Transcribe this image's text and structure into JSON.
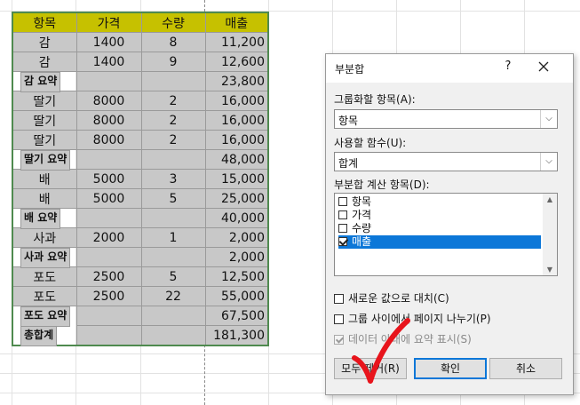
{
  "sheet": {
    "headers": [
      "항목",
      "가격",
      "수량",
      "매출"
    ],
    "rows": [
      {
        "item": "감",
        "price": "1400",
        "qty": "8",
        "sales": "11,200",
        "type": "data"
      },
      {
        "item": "감",
        "price": "1400",
        "qty": "9",
        "sales": "12,600",
        "type": "data"
      },
      {
        "item": "감 요약",
        "price": "",
        "qty": "",
        "sales": "23,800",
        "type": "sum"
      },
      {
        "item": "딸기",
        "price": "8000",
        "qty": "2",
        "sales": "16,000",
        "type": "data"
      },
      {
        "item": "딸기",
        "price": "8000",
        "qty": "2",
        "sales": "16,000",
        "type": "data"
      },
      {
        "item": "딸기",
        "price": "8000",
        "qty": "2",
        "sales": "16,000",
        "type": "data"
      },
      {
        "item": "딸기 요약",
        "price": "",
        "qty": "",
        "sales": "48,000",
        "type": "sum"
      },
      {
        "item": "배",
        "price": "5000",
        "qty": "3",
        "sales": "15,000",
        "type": "data"
      },
      {
        "item": "배",
        "price": "5000",
        "qty": "5",
        "sales": "25,000",
        "type": "data"
      },
      {
        "item": "배 요약",
        "price": "",
        "qty": "",
        "sales": "40,000",
        "type": "sum"
      },
      {
        "item": "사과",
        "price": "2000",
        "qty": "1",
        "sales": "2,000",
        "type": "data"
      },
      {
        "item": "사과  요약",
        "price": "",
        "qty": "",
        "sales": "2,000",
        "type": "sum"
      },
      {
        "item": "포도",
        "price": "2500",
        "qty": "5",
        "sales": "12,500",
        "type": "data"
      },
      {
        "item": "포도",
        "price": "2500",
        "qty": "22",
        "sales": "55,000",
        "type": "data"
      },
      {
        "item": "포도 요약",
        "price": "",
        "qty": "",
        "sales": "67,500",
        "type": "sum"
      },
      {
        "item": "총합계",
        "price": "",
        "qty": "",
        "sales": "181,300",
        "type": "sum"
      }
    ]
  },
  "dialog": {
    "title": "부분합",
    "help": "?",
    "group_label": "그룹화할 항목(A):",
    "group_value": "항목",
    "func_label": "사용할 함수(U):",
    "func_value": "합계",
    "calc_label": "부분합 계산 항목(D):",
    "calc_items": [
      {
        "label": "항목",
        "checked": false,
        "selected": false
      },
      {
        "label": "가격",
        "checked": false,
        "selected": false
      },
      {
        "label": "수량",
        "checked": false,
        "selected": false
      },
      {
        "label": "매출",
        "checked": true,
        "selected": true
      }
    ],
    "opt_replace": "새로운 값으로 대치(C)",
    "opt_pagebreak": "그룹 사이에서 페이지 나누기(P)",
    "opt_summary": "데이터 아래에 요약 표시(S)",
    "btn_remove": "모두 제거(R)",
    "btn_ok": "확인",
    "btn_cancel": "취소"
  },
  "colors": {
    "header_fill": "#c6c100",
    "cell_fill": "#c8c8c8",
    "selection": "#0c77d8",
    "annotation": "#e8141c"
  },
  "annotation": {
    "icon": "red-checkmark-icon"
  }
}
